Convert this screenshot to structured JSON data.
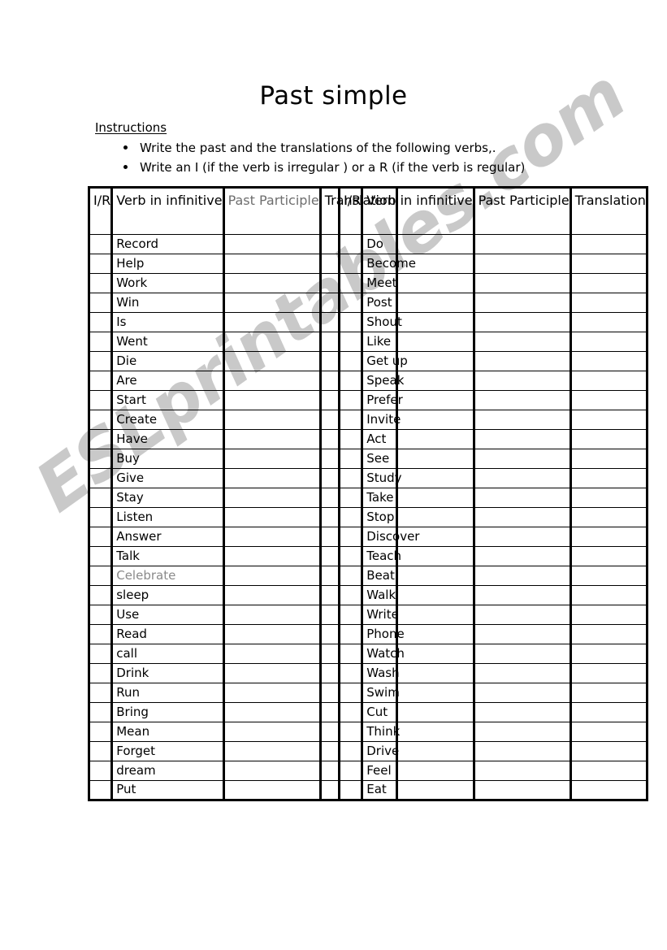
{
  "page": {
    "title": "Past simple",
    "watermark": "ESLprintables.com",
    "watermark_color": "#c9c9c9"
  },
  "instructions": {
    "heading": "Instructions",
    "bullets": [
      "Write the past and the translations of the following verbs,.",
      "Write an I (if the verb is irregular ) or a R (if the verb is regular)"
    ]
  },
  "tables": [
    {
      "id": "left-table",
      "headers": [
        "I/R",
        "Verb in infinitive",
        "Past Participle",
        "Translation"
      ],
      "header_faint_index": 2,
      "rows": [
        {
          "ir": "",
          "verb": "Record",
          "pp": "",
          "translation": ""
        },
        {
          "ir": "",
          "verb": "Help",
          "pp": "",
          "translation": ""
        },
        {
          "ir": "",
          "verb": "Work",
          "pp": "",
          "translation": ""
        },
        {
          "ir": "",
          "verb": "Win",
          "pp": "",
          "translation": ""
        },
        {
          "ir": "",
          "verb": "Is",
          "pp": "",
          "translation": ""
        },
        {
          "ir": "",
          "verb": "Went",
          "pp": "",
          "translation": ""
        },
        {
          "ir": "",
          "verb": "Die",
          "pp": "",
          "translation": ""
        },
        {
          "ir": "",
          "verb": "Are",
          "pp": "",
          "translation": ""
        },
        {
          "ir": "",
          "verb": "Start",
          "pp": "",
          "translation": ""
        },
        {
          "ir": "",
          "verb": "Create",
          "pp": "",
          "translation": ""
        },
        {
          "ir": "",
          "verb": "Have",
          "pp": "",
          "translation": ""
        },
        {
          "ir": "",
          "verb": "Buy",
          "pp": "",
          "translation": ""
        },
        {
          "ir": "",
          "verb": "Give",
          "pp": "",
          "translation": ""
        },
        {
          "ir": "",
          "verb": "Stay",
          "pp": "",
          "translation": ""
        },
        {
          "ir": "",
          "verb": "Listen",
          "pp": "",
          "translation": ""
        },
        {
          "ir": "",
          "verb": "Answer",
          "pp": "",
          "translation": ""
        },
        {
          "ir": "",
          "verb": "Talk",
          "pp": "",
          "translation": ""
        },
        {
          "ir": "",
          "verb": "Celebrate",
          "pp": "",
          "translation": "",
          "faint": true
        },
        {
          "ir": "",
          "verb": "sleep",
          "pp": "",
          "translation": ""
        },
        {
          "ir": "",
          "verb": "Use",
          "pp": "",
          "translation": ""
        },
        {
          "ir": "",
          "verb": "Read",
          "pp": "",
          "translation": ""
        },
        {
          "ir": "",
          "verb": "call",
          "pp": "",
          "translation": ""
        },
        {
          "ir": "",
          "verb": "Drink",
          "pp": "",
          "translation": ""
        },
        {
          "ir": "",
          "verb": "Run",
          "pp": "",
          "translation": ""
        },
        {
          "ir": "",
          "verb": "Bring",
          "pp": "",
          "translation": ""
        },
        {
          "ir": "",
          "verb": "Mean",
          "pp": "",
          "translation": ""
        },
        {
          "ir": "",
          "verb": "Forget",
          "pp": "",
          "translation": ""
        },
        {
          "ir": "",
          "verb": "dream",
          "pp": "",
          "translation": ""
        },
        {
          "ir": "",
          "verb": "Put",
          "pp": "",
          "translation": ""
        }
      ]
    },
    {
      "id": "right-table",
      "headers": [
        "I/R",
        "Verb in infinitive",
        "Past Participle",
        "Translation"
      ],
      "header_faint_index": -1,
      "rows": [
        {
          "ir": "",
          "verb": "Do",
          "pp": "",
          "translation": ""
        },
        {
          "ir": "",
          "verb": "Become",
          "pp": "",
          "translation": ""
        },
        {
          "ir": "",
          "verb": "Meet",
          "pp": "",
          "translation": ""
        },
        {
          "ir": "",
          "verb": "Post",
          "pp": "",
          "translation": ""
        },
        {
          "ir": "",
          "verb": "Shout",
          "pp": "",
          "translation": ""
        },
        {
          "ir": "",
          "verb": "Like",
          "pp": "",
          "translation": ""
        },
        {
          "ir": "",
          "verb": "Get up",
          "pp": "",
          "translation": ""
        },
        {
          "ir": "",
          "verb": "Speak",
          "pp": "",
          "translation": ""
        },
        {
          "ir": "",
          "verb": "Prefer",
          "pp": "",
          "translation": ""
        },
        {
          "ir": "",
          "verb": "Invite",
          "pp": "",
          "translation": ""
        },
        {
          "ir": "",
          "verb": "Act",
          "pp": "",
          "translation": ""
        },
        {
          "ir": "",
          "verb": "See",
          "pp": "",
          "translation": ""
        },
        {
          "ir": "",
          "verb": "Study",
          "pp": "",
          "translation": ""
        },
        {
          "ir": "",
          "verb": "Take",
          "pp": "",
          "translation": ""
        },
        {
          "ir": "",
          "verb": "Stop",
          "pp": "",
          "translation": ""
        },
        {
          "ir": "",
          "verb": "Discover",
          "pp": "",
          "translation": ""
        },
        {
          "ir": "",
          "verb": "Teach",
          "pp": "",
          "translation": ""
        },
        {
          "ir": "",
          "verb": "Beat",
          "pp": "",
          "translation": ""
        },
        {
          "ir": "",
          "verb": "Walk",
          "pp": "",
          "translation": ""
        },
        {
          "ir": "",
          "verb": "Write",
          "pp": "",
          "translation": ""
        },
        {
          "ir": "",
          "verb": "Phone",
          "pp": "",
          "translation": ""
        },
        {
          "ir": "",
          "verb": "Watch",
          "pp": "",
          "translation": ""
        },
        {
          "ir": "",
          "verb": "Wash",
          "pp": "",
          "translation": ""
        },
        {
          "ir": "",
          "verb": "Swim",
          "pp": "",
          "translation": ""
        },
        {
          "ir": "",
          "verb": "Cut",
          "pp": "",
          "translation": ""
        },
        {
          "ir": "",
          "verb": "Think",
          "pp": "",
          "translation": ""
        },
        {
          "ir": "",
          "verb": "Drive",
          "pp": "",
          "translation": ""
        },
        {
          "ir": "",
          "verb": "Feel",
          "pp": "",
          "translation": ""
        },
        {
          "ir": "",
          "verb": "Eat",
          "pp": "",
          "translation": ""
        }
      ]
    }
  ]
}
